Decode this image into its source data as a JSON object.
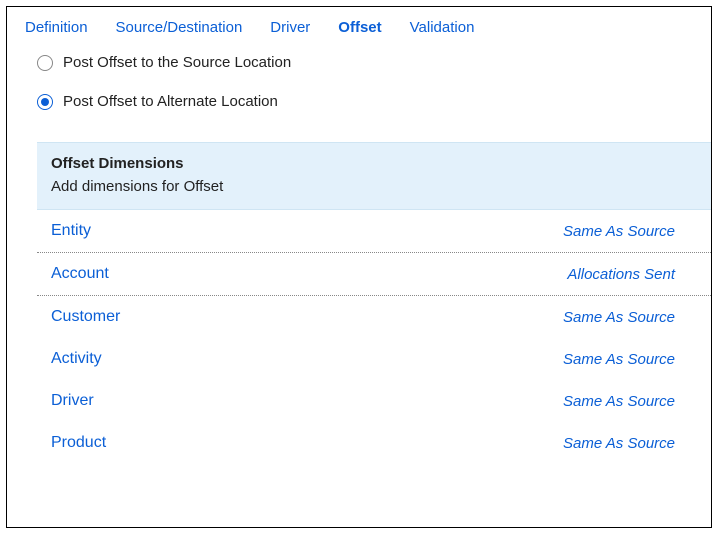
{
  "tabs": [
    {
      "label": "Definition",
      "active": false
    },
    {
      "label": "Source/Destination",
      "active": false
    },
    {
      "label": "Driver",
      "active": false
    },
    {
      "label": "Offset",
      "active": true
    },
    {
      "label": "Validation",
      "active": false
    }
  ],
  "radios": {
    "source": {
      "label": "Post Offset to the Source Location",
      "selected": false
    },
    "alternate": {
      "label": "Post Offset to Alternate Location",
      "selected": true
    }
  },
  "dimensions": {
    "title": "Offset Dimensions",
    "subtitle": "Add dimensions for Offset",
    "rows": [
      {
        "name": "Entity",
        "value": "Same As Source",
        "bordered": true
      },
      {
        "name": "Account",
        "value": "Allocations Sent",
        "bordered": true
      },
      {
        "name": "Customer",
        "value": "Same As Source",
        "bordered": false
      },
      {
        "name": "Activity",
        "value": "Same As Source",
        "bordered": false
      },
      {
        "name": "Driver",
        "value": "Same As Source",
        "bordered": false
      },
      {
        "name": "Product",
        "value": "Same As Source",
        "bordered": false
      }
    ]
  }
}
